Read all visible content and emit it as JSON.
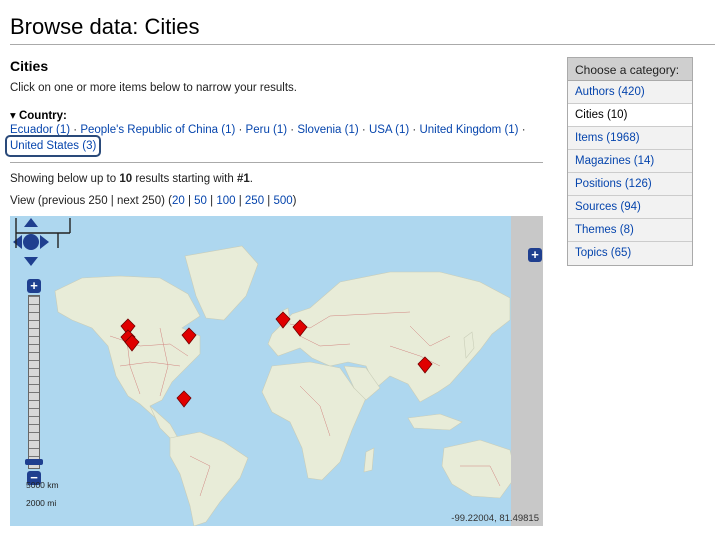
{
  "page": {
    "title": "Browse data: Cities"
  },
  "results": {
    "heading": "Cities",
    "intro": "Click on one or more items below to narrow your results."
  },
  "facet": {
    "title": "▾ Country:",
    "items": [
      {
        "label": "Ecuador (1)"
      },
      {
        "label": "People's Republic of China (1)"
      },
      {
        "label": "Peru (1)"
      },
      {
        "label": "Slovenia (1)"
      },
      {
        "label": "USA (1)"
      },
      {
        "label": "United Kingdom (1)"
      },
      {
        "label": "United States (3)"
      }
    ],
    "separator": " · "
  },
  "showing": {
    "prefix": "Showing below up to ",
    "count": "10",
    "middle": " results starting with ",
    "start": "#1",
    "suffix": "."
  },
  "view": {
    "prefix": "View (previous 250 | next 250) (",
    "options": [
      "20",
      "50",
      "100",
      "250",
      "500"
    ],
    "suffix": ")"
  },
  "map": {
    "scale_km": "5000 km",
    "scale_mi": "2000 mi",
    "coords": "-99.22004, 81.49815",
    "colors": {
      "water": "#aed7ef",
      "land": "#e8ecd8",
      "marker": "#e00000"
    }
  },
  "sidebar": {
    "header": "Choose a category:",
    "items": [
      {
        "label": "Authors (420)"
      },
      {
        "label": "Cities (10)"
      },
      {
        "label": "Items (1968)"
      },
      {
        "label": "Magazines (14)"
      },
      {
        "label": "Positions (126)"
      },
      {
        "label": "Sources (94)"
      },
      {
        "label": "Themes (8)"
      },
      {
        "label": "Topics (65)"
      }
    ]
  }
}
